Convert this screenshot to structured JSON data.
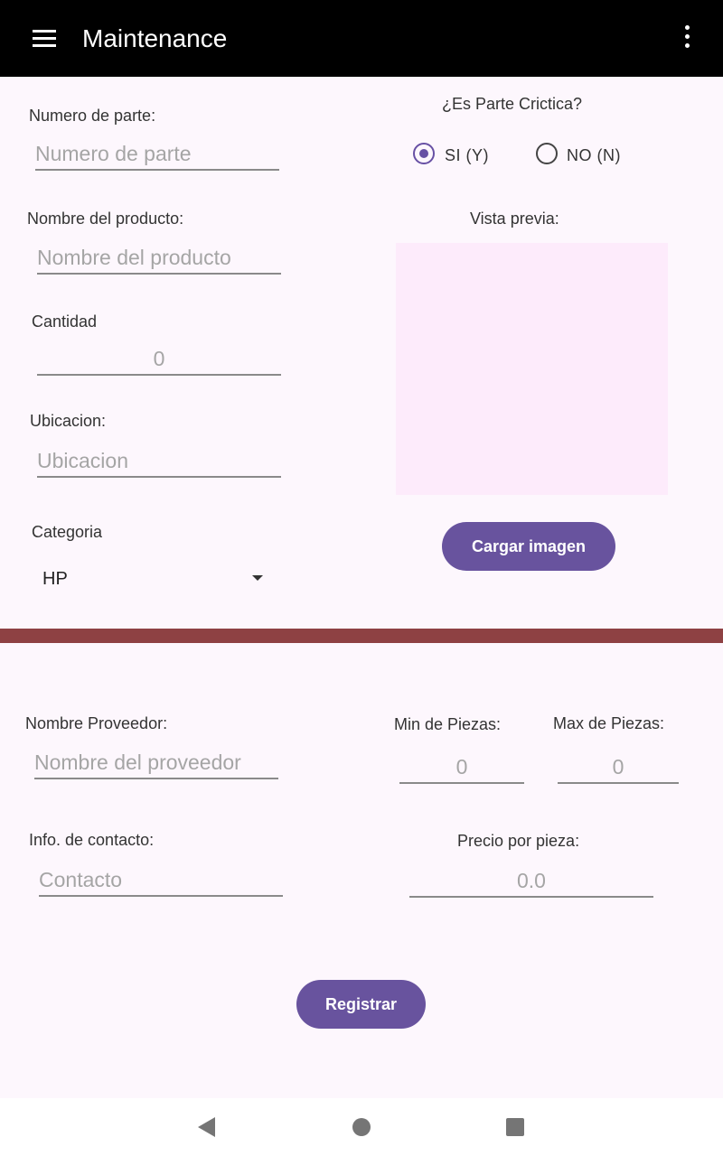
{
  "appbar": {
    "title": "Maintenance",
    "menu_icon": "menu-icon",
    "overflow_icon": "more-vert-icon"
  },
  "form": {
    "part_number": {
      "label": "Numero de parte:",
      "placeholder": "Numero de parte"
    },
    "critical": {
      "label": "¿Es Parte Crictica?",
      "options": [
        "SI (Y)",
        "NO (N)"
      ],
      "selected": "SI (Y)",
      "accent": "#6750a4"
    },
    "product_name": {
      "label": "Nombre del producto:",
      "placeholder": "Nombre del producto"
    },
    "preview": {
      "label": "Vista previa:"
    },
    "quantity": {
      "label": "Cantidad",
      "placeholder": "0"
    },
    "location": {
      "label": "Ubicacion:",
      "placeholder": "Ubicacion"
    },
    "upload_button": "Cargar imagen",
    "category": {
      "label": "Categoria",
      "value": "HP"
    }
  },
  "supplier": {
    "name": {
      "label": "Nombre Proveedor:",
      "placeholder": "Nombre del proveedor"
    },
    "min_pieces": {
      "label": "Min de Piezas:",
      "placeholder": "0"
    },
    "max_pieces": {
      "label": "Max de Piezas:",
      "placeholder": "0"
    },
    "contact": {
      "label": "Info. de contacto:",
      "placeholder": "Contacto"
    },
    "price": {
      "label": "Precio por pieza:",
      "placeholder": "0.0"
    },
    "register_button": "Registrar"
  },
  "colors": {
    "appbar": "#000000",
    "button": "#68539e",
    "divider": "#8e4143",
    "background": "#fdf7fd"
  },
  "navbar": {
    "icons": [
      "back-icon",
      "home-icon",
      "recents-icon"
    ]
  }
}
